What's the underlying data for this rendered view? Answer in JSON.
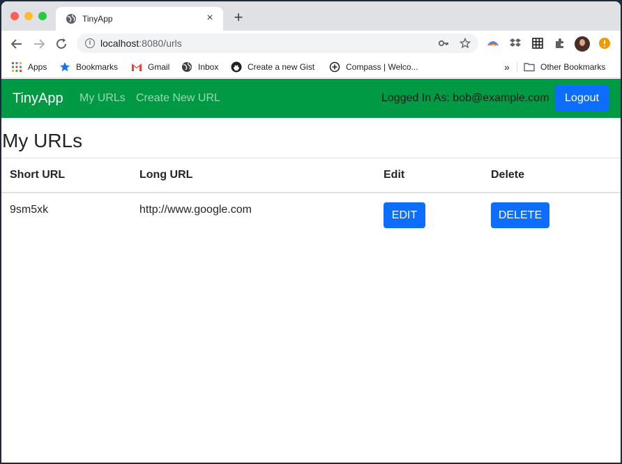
{
  "browser": {
    "tab_title": "TinyApp",
    "tab_close": "×",
    "new_tab": "+",
    "url_host": "localhost",
    "url_path": ":8080/urls",
    "bookmarks": [
      "Apps",
      "Bookmarks",
      "Gmail",
      "Inbox",
      "Create a new Gist",
      "Compass | Welco..."
    ],
    "bookmarks_overflow": "»",
    "other_bookmarks": "Other Bookmarks"
  },
  "navbar": {
    "brand": "TinyApp",
    "links": [
      "My URLs",
      "Create New URL"
    ],
    "logged_in": "Logged In As: bob@example.com",
    "logout": "Logout",
    "color": "#009a44"
  },
  "page": {
    "title": "My URLs",
    "table": {
      "headers": [
        "Short URL",
        "Long URL",
        "Edit",
        "Delete"
      ],
      "rows": [
        {
          "short_url": "9sm5xk",
          "long_url": "http://www.google.com",
          "edit": "EDIT",
          "delete": "DELETE"
        }
      ]
    },
    "accent": "#0d6efd"
  }
}
